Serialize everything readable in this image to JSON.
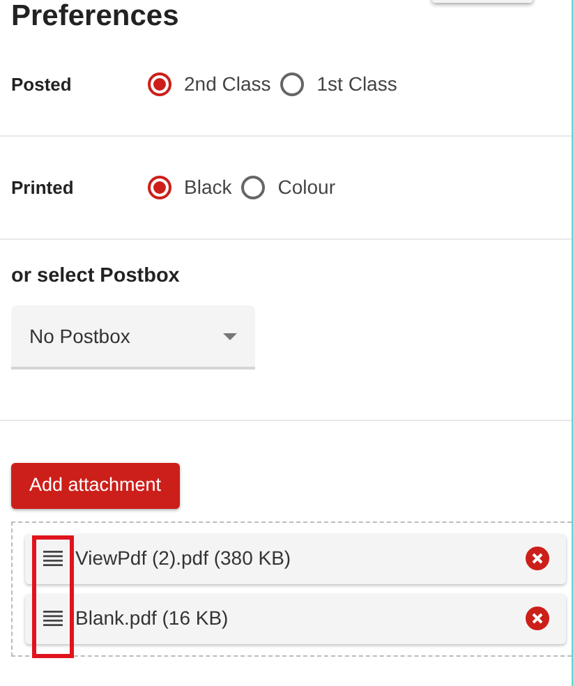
{
  "title": "Preferences",
  "options": [
    {
      "label": "Posted",
      "choices": [
        {
          "label": "2nd Class",
          "selected": true
        },
        {
          "label": "1st Class",
          "selected": false
        }
      ]
    },
    {
      "label": "Printed",
      "choices": [
        {
          "label": "Black",
          "selected": true
        },
        {
          "label": "Colour",
          "selected": false
        }
      ]
    }
  ],
  "postbox": {
    "heading": "or select Postbox",
    "value": "No Postbox"
  },
  "add_button": "Add attachment",
  "attachments": [
    {
      "name": "ViewPdf (2).pdf (380 KB)"
    },
    {
      "name": "Blank.pdf (16 KB)"
    }
  ],
  "handles_highlighted": true
}
